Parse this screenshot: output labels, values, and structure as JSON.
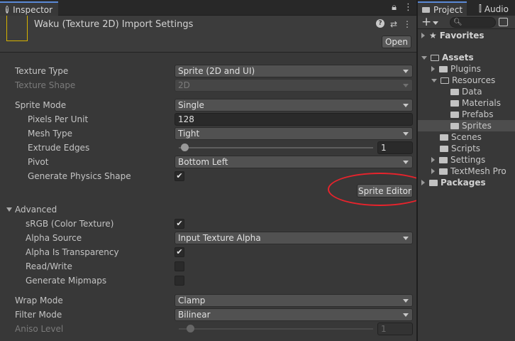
{
  "inspector": {
    "tab_label": "Inspector",
    "tab_icon": "!",
    "header_title": "Waku (Texture 2D) Import Settings",
    "help_icon_glyph": "?",
    "open_label": "Open"
  },
  "fields": {
    "texture_type": {
      "label": "Texture Type",
      "value": "Sprite (2D and UI)"
    },
    "texture_shape": {
      "label": "Texture Shape",
      "value": "2D"
    },
    "sprite_mode": {
      "label": "Sprite Mode",
      "value": "Single"
    },
    "pixels_per_unit": {
      "label": "Pixels Per Unit",
      "value": "128"
    },
    "mesh_type": {
      "label": "Mesh Type",
      "value": "Tight"
    },
    "extrude_edges": {
      "label": "Extrude Edges",
      "value": "1",
      "fraction": 0.03
    },
    "pivot": {
      "label": "Pivot",
      "value": "Bottom Left"
    },
    "generate_physics_shape": {
      "label": "Generate Physics Shape",
      "checked": true
    },
    "sprite_editor_label": "Sprite Editor",
    "advanced_label": "Advanced",
    "srgb": {
      "label": "sRGB (Color Texture)",
      "checked": true
    },
    "alpha_source": {
      "label": "Alpha Source",
      "value": "Input Texture Alpha"
    },
    "alpha_is_transparency": {
      "label": "Alpha Is Transparency",
      "checked": true
    },
    "read_write": {
      "label": "Read/Write",
      "checked": false
    },
    "generate_mipmaps": {
      "label": "Generate Mipmaps",
      "checked": false
    },
    "wrap_mode": {
      "label": "Wrap Mode",
      "value": "Clamp"
    },
    "filter_mode": {
      "label": "Filter Mode",
      "value": "Bilinear"
    },
    "aniso_level": {
      "label": "Aniso Level",
      "value": "1",
      "fraction": 0.06
    }
  },
  "project": {
    "tab_project": "Project",
    "tab_audio": "Audio",
    "tree": {
      "favorites": "Favorites",
      "assets": "Assets",
      "plugins": "Plugins",
      "resources": "Resources",
      "data": "Data",
      "materials": "Materials",
      "prefabs": "Prefabs",
      "sprites": "Sprites",
      "scenes": "Scenes",
      "scripts": "Scripts",
      "settings": "Settings",
      "textmesh_pro": "TextMesh Pro",
      "packages": "Packages"
    }
  },
  "colors": {
    "annotation": "#e8232c",
    "tab_accent": "#5a89d6",
    "panel_bg": "#383838"
  }
}
